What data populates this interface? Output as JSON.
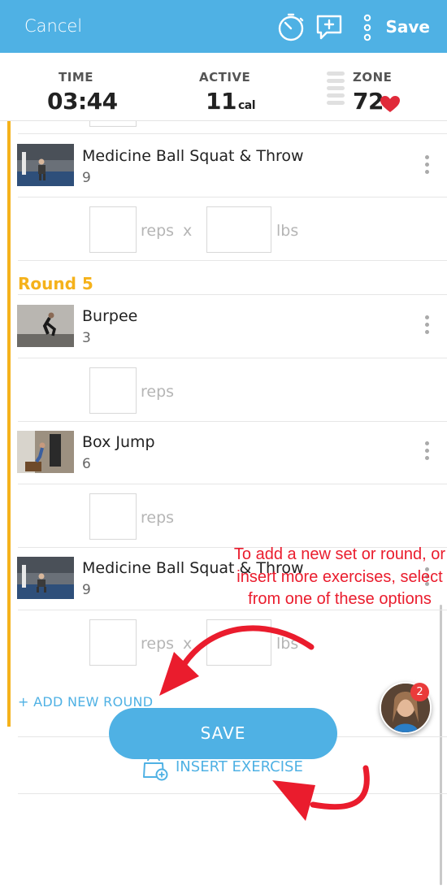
{
  "header": {
    "cancel_label": "Cancel",
    "save_label": "Save"
  },
  "stats": {
    "time_label": "TIME",
    "time_value": "03:44",
    "active_label": "ACTIVE",
    "active_value": "11",
    "active_unit": "cal",
    "zone_label": "ZONE",
    "zone_value": "72"
  },
  "exercises": [
    {
      "name": "Medicine Ball Squat & Throw",
      "count": "9"
    },
    {
      "name": "Burpee",
      "count": "3"
    },
    {
      "name": "Box Jump",
      "count": "6"
    },
    {
      "name": "Medicine Ball Squat & Throw",
      "count": "9"
    }
  ],
  "inputs": {
    "reps_label": "reps",
    "x_label": "x",
    "lbs_label": "lbs"
  },
  "round_title": "Round 5",
  "add_round_label": "+ ADD NEW ROUND",
  "insert_exercise_label": "INSERT EXERCISE",
  "save_button_label": "SAVE",
  "annotation_text": "To add a new set or round, or insert more exercises, select from one of these options",
  "chat_badge_count": "2",
  "colors": {
    "accent": "#4fb1e4",
    "round": "#f5b21b",
    "heart": "#e02a3a",
    "annotation": "#ea1c2d"
  }
}
